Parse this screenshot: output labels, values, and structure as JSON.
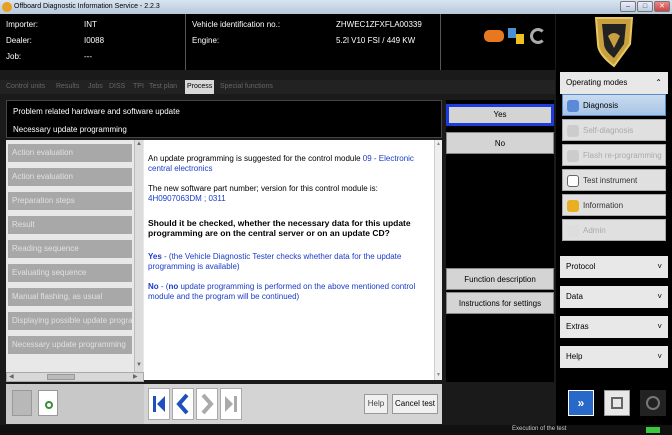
{
  "window": {
    "title": "Offboard Diagnostic Information Service - 2.2.3",
    "controls": [
      "–",
      "□",
      "✕"
    ]
  },
  "header": {
    "importer_label": "Importer:",
    "importer_value": "INT",
    "dealer_label": "Dealer:",
    "dealer_value": "I0088",
    "job_label": "Job:",
    "job_value": "---",
    "vin_label": "Vehicle identification no.:",
    "vin_value": "ZHWEC1ZFXFLA00339",
    "engine_label": "Engine:",
    "engine_value": "5.2l V10 FSI / 449 KW"
  },
  "tabs": [
    {
      "label": "Control units"
    },
    {
      "label": "Results"
    },
    {
      "label": "Jobs"
    },
    {
      "label": "DISS"
    },
    {
      "label": "TPI"
    },
    {
      "label": "Test plan"
    },
    {
      "label": "Process",
      "active": true
    },
    {
      "label": "Special functions"
    }
  ],
  "problem": {
    "line1": "Problem related hardware and software update",
    "line2": "Necessary update programming"
  },
  "left_list": [
    "Action evaluation",
    "Action evaluation",
    "Preparation steps",
    "Result",
    "Reading sequence",
    "Evaluating sequence",
    "Manual flashing, as usual",
    "Displaying possible update program",
    "Necessary update programming"
  ],
  "content": {
    "p1_pre": "An update programming is suggested for the control module ",
    "p1_link": "09 - Electronic central electronics",
    "p2_pre": "The new software part number; version for this control module is:",
    "p2_value": "4H0907063DM ; 0311",
    "p3": "Should it be checked, whether the necessary data for this update programming are on the central server or on an update CD?",
    "p4_bold": "Yes",
    "p4_rest": " - (the Vehicle Diagnostic Tester checks whether data for the update programming is available)",
    "p5_bold": "No",
    "p5_mid": " - (",
    "p5_no": "no",
    "p5_rest": " update programming is performed on the above mentioned control module and the program will be continued)"
  },
  "answers": {
    "yes": "Yes",
    "no": "No",
    "function_description": "Function description",
    "instructions": "Instructions for settings"
  },
  "bottom": {
    "help": "Help",
    "cancel_test": "Cancel test"
  },
  "sidebar": {
    "operating_modes": "Operating modes",
    "items": [
      {
        "label": "Diagnosis",
        "state": "selected"
      },
      {
        "label": "Self-diagnosis",
        "state": "disabled"
      },
      {
        "label": "Flash re-programming",
        "state": "disabled"
      },
      {
        "label": "Test instrument",
        "state": "normal"
      },
      {
        "label": "Information",
        "state": "normal"
      },
      {
        "label": "Admin",
        "state": "disabled"
      }
    ],
    "sections": [
      "Protocol",
      "Data",
      "Extras",
      "Help"
    ]
  },
  "status": {
    "text": "Execution of the test"
  },
  "colors": {
    "accent_blue": "#1e3cdc",
    "link_blue": "#1a3cc8",
    "nav_arrow": "#2050c0"
  }
}
